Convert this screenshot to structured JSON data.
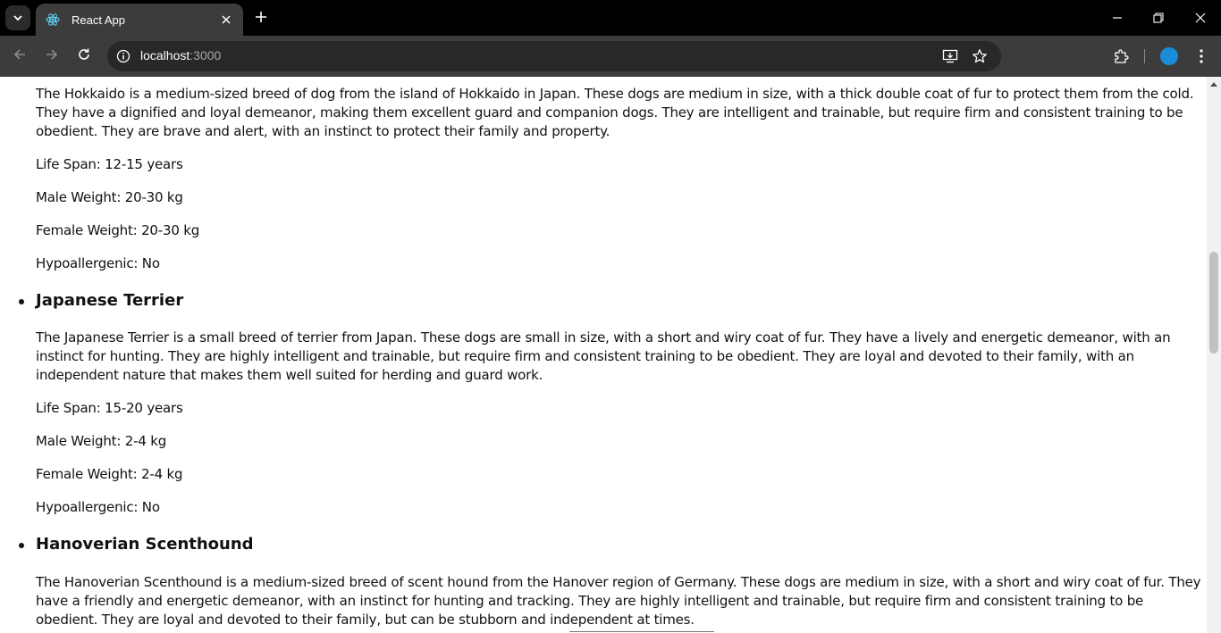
{
  "browser": {
    "tab_title": "React App",
    "url_host": "localhost",
    "url_port": ":3000",
    "accent_profile_color": "#1a8cd8"
  },
  "icons": {
    "tab_search": "chevron-down-icon",
    "favicon": "react-logo-icon",
    "tab_close": "close-icon",
    "new_tab": "plus-icon",
    "minimize": "minimize-icon",
    "restore": "restore-icon",
    "close_window": "close-icon",
    "back": "arrow-left-icon",
    "forward": "arrow-right-icon",
    "reload": "reload-icon",
    "site_info": "info-icon",
    "install": "install-app-icon",
    "bookmark": "star-icon",
    "extensions": "puzzle-icon",
    "menu": "kebab-menu-icon"
  },
  "page": {
    "hokkaido": {
      "description": "The Hokkaido is a medium-sized breed of dog from the island of Hokkaido in Japan. These dogs are medium in size, with a thick double coat of fur to protect them from the cold. They have a dignified and loyal demeanor, making them excellent guard and companion dogs. They are intelligent and trainable, but require firm and consistent training to be obedient. They are brave and alert, with an instinct to protect their family and property.",
      "life_span": "Life Span: 12-15 years",
      "male_weight": "Male Weight: 20-30 kg",
      "female_weight": "Female Weight: 20-30 kg",
      "hypoallergenic": "Hypoallergenic: No"
    },
    "japanese_terrier": {
      "name": "Japanese Terrier",
      "description": "The Japanese Terrier is a small breed of terrier from Japan. These dogs are small in size, with a short and wiry coat of fur. They have a lively and energetic demeanor, with an instinct for hunting. They are highly intelligent and trainable, but require firm and consistent training to be obedient. They are loyal and devoted to their family, with an independent nature that makes them well suited for herding and guard work.",
      "life_span": "Life Span: 15-20 years",
      "male_weight": "Male Weight: 2-4 kg",
      "female_weight": "Female Weight: 2-4 kg",
      "hypoallergenic": "Hypoallergenic: No"
    },
    "hanoverian": {
      "name": "Hanoverian Scenthound",
      "description": "The Hanoverian Scenthound is a medium-sized breed of scent hound from the Hanover region of Germany. These dogs are medium in size, with a short and wiry coat of fur. They have a friendly and energetic demeanor, with an instinct for hunting and tracking. They are highly intelligent and trainable, but require firm and consistent training to be obedient. They are loyal and devoted to their family, but can be stubborn and independent at times."
    }
  }
}
